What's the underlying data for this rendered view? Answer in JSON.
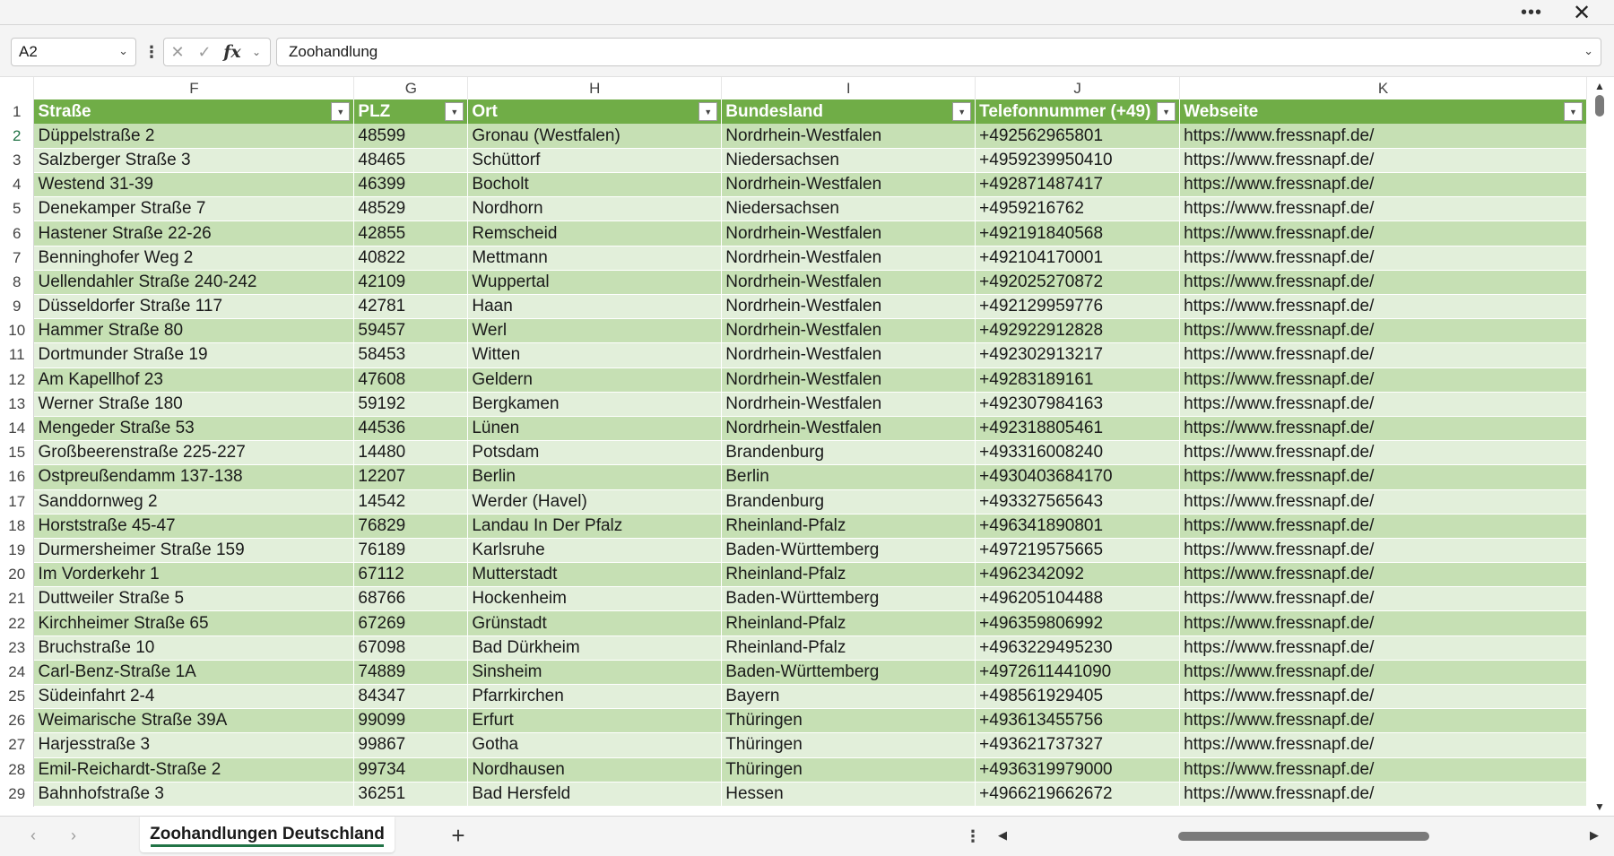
{
  "window": {
    "more_icon": "more-icon",
    "close_icon": "close-icon"
  },
  "formula_bar": {
    "name_box": "A2",
    "formula": "Zoohandlung",
    "icons": [
      "cancel-icon",
      "enter-icon",
      "function-icon"
    ]
  },
  "columns": [
    "F",
    "G",
    "H",
    "I",
    "J",
    "K"
  ],
  "header_row": [
    "Straße",
    "PLZ",
    "Ort",
    "Bundesland",
    "Telefonnummer (+49)",
    "Webseite"
  ],
  "rows": [
    {
      "n": "2",
      "cells": [
        "Düppelstraße 2",
        "48599",
        "Gronau (Westfalen)",
        "Nordrhein-Westfalen",
        "+492562965801",
        "https://www.fressnapf.de/"
      ]
    },
    {
      "n": "3",
      "cells": [
        "Salzberger Straße 3",
        "48465",
        "Schüttorf",
        "Niedersachsen",
        "+4959239950410",
        "https://www.fressnapf.de/"
      ]
    },
    {
      "n": "4",
      "cells": [
        "Westend 31-39",
        "46399",
        "Bocholt",
        "Nordrhein-Westfalen",
        "+492871487417",
        "https://www.fressnapf.de/"
      ]
    },
    {
      "n": "5",
      "cells": [
        "Denekamper Straße 7",
        "48529",
        "Nordhorn",
        "Niedersachsen",
        "+4959216762",
        "https://www.fressnapf.de/"
      ]
    },
    {
      "n": "6",
      "cells": [
        "Hastener Straße 22-26",
        "42855",
        "Remscheid",
        "Nordrhein-Westfalen",
        "+492191840568",
        "https://www.fressnapf.de/"
      ]
    },
    {
      "n": "7",
      "cells": [
        "Benninghofer Weg 2",
        "40822",
        "Mettmann",
        "Nordrhein-Westfalen",
        "+492104170001",
        "https://www.fressnapf.de/"
      ]
    },
    {
      "n": "8",
      "cells": [
        "Uellendahler Straße 240-242",
        "42109",
        "Wuppertal",
        "Nordrhein-Westfalen",
        "+492025270872",
        "https://www.fressnapf.de/"
      ]
    },
    {
      "n": "9",
      "cells": [
        "Düsseldorfer Straße 117",
        "42781",
        "Haan",
        "Nordrhein-Westfalen",
        "+492129959776",
        "https://www.fressnapf.de/"
      ]
    },
    {
      "n": "10",
      "cells": [
        "Hammer Straße 80",
        "59457",
        "Werl",
        "Nordrhein-Westfalen",
        "+492922912828",
        "https://www.fressnapf.de/"
      ]
    },
    {
      "n": "11",
      "cells": [
        "Dortmunder Straße 19",
        "58453",
        "Witten",
        "Nordrhein-Westfalen",
        "+492302913217",
        "https://www.fressnapf.de/"
      ]
    },
    {
      "n": "12",
      "cells": [
        "Am Kapellhof 23",
        "47608",
        "Geldern",
        "Nordrhein-Westfalen",
        "+49283189161",
        "https://www.fressnapf.de/"
      ]
    },
    {
      "n": "13",
      "cells": [
        "Werner Straße 180",
        "59192",
        "Bergkamen",
        "Nordrhein-Westfalen",
        "+492307984163",
        "https://www.fressnapf.de/"
      ]
    },
    {
      "n": "14",
      "cells": [
        "Mengeder Straße 53",
        "44536",
        "Lünen",
        "Nordrhein-Westfalen",
        "+492318805461",
        "https://www.fressnapf.de/"
      ]
    },
    {
      "n": "15",
      "cells": [
        "Großbeerenstraße 225-227",
        "14480",
        "Potsdam",
        "Brandenburg",
        "+493316008240",
        "https://www.fressnapf.de/"
      ]
    },
    {
      "n": "16",
      "cells": [
        "Ostpreußendamm 137-138",
        "12207",
        "Berlin",
        "Berlin",
        "+4930403684170",
        "https://www.fressnapf.de/"
      ]
    },
    {
      "n": "17",
      "cells": [
        "Sanddornweg 2",
        "14542",
        "Werder (Havel)",
        "Brandenburg",
        "+493327565643",
        "https://www.fressnapf.de/"
      ]
    },
    {
      "n": "18",
      "cells": [
        "Horststraße 45-47",
        "76829",
        "Landau In Der Pfalz",
        "Rheinland-Pfalz",
        "+496341890801",
        "https://www.fressnapf.de/"
      ]
    },
    {
      "n": "19",
      "cells": [
        "Durmersheimer Straße 159",
        "76189",
        "Karlsruhe",
        "Baden-Württemberg",
        "+497219575665",
        "https://www.fressnapf.de/"
      ]
    },
    {
      "n": "20",
      "cells": [
        "Im Vorderkehr 1",
        "67112",
        "Mutterstadt",
        "Rheinland-Pfalz",
        "+4962342092",
        "https://www.fressnapf.de/"
      ]
    },
    {
      "n": "21",
      "cells": [
        "Duttweiler Straße 5",
        "68766",
        "Hockenheim",
        "Baden-Württemberg",
        "+496205104488",
        "https://www.fressnapf.de/"
      ]
    },
    {
      "n": "22",
      "cells": [
        "Kirchheimer Straße 65",
        "67269",
        "Grünstadt",
        "Rheinland-Pfalz",
        "+496359806992",
        "https://www.fressnapf.de/"
      ]
    },
    {
      "n": "23",
      "cells": [
        "Bruchstraße 10",
        "67098",
        "Bad Dürkheim",
        "Rheinland-Pfalz",
        "+4963229495230",
        "https://www.fressnapf.de/"
      ]
    },
    {
      "n": "24",
      "cells": [
        "Carl-Benz-Straße 1A",
        "74889",
        "Sinsheim",
        "Baden-Württemberg",
        "+4972611441090",
        "https://www.fressnapf.de/"
      ]
    },
    {
      "n": "25",
      "cells": [
        "Südeinfahrt 2-4",
        "84347",
        "Pfarrkirchen",
        "Bayern",
        "+498561929405",
        "https://www.fressnapf.de/"
      ]
    },
    {
      "n": "26",
      "cells": [
        "Weimarische Straße 39A",
        "99099",
        "Erfurt",
        "Thüringen",
        "+493613455756",
        "https://www.fressnapf.de/"
      ]
    },
    {
      "n": "27",
      "cells": [
        "Harjesstraße 3",
        "99867",
        "Gotha",
        "Thüringen",
        "+493621737327",
        "https://www.fressnapf.de/"
      ]
    },
    {
      "n": "28",
      "cells": [
        "Emil-Reichardt-Straße 2",
        "99734",
        "Nordhausen",
        "Thüringen",
        "+4936319979000",
        "https://www.fressnapf.de/"
      ]
    },
    {
      "n": "29",
      "cells": [
        "Bahnhofstraße 3",
        "36251",
        "Bad Hersfeld",
        "Hessen",
        "+4966219662672",
        "https://www.fressnapf.de/"
      ]
    }
  ],
  "sheet_tabs": [
    "Zoohandlungen Deutschland"
  ],
  "colors": {
    "header_bg": "#70ad47",
    "band_dark": "#c6e0b4",
    "band_light": "#e2efda",
    "accent": "#217346"
  }
}
